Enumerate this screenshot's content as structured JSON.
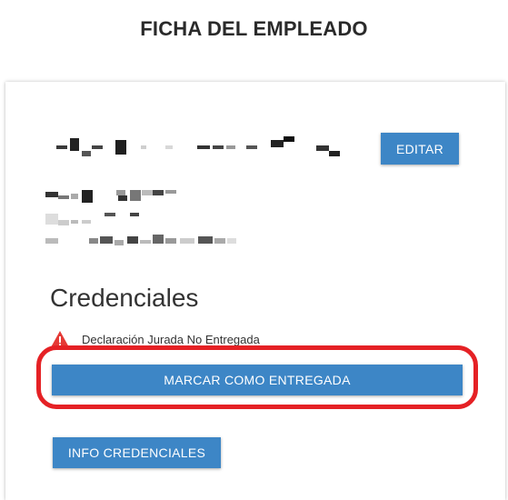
{
  "header": {
    "title": "FICHA DEL EMPLEADO"
  },
  "card": {
    "edit_label": "EDITAR",
    "credentials": {
      "title": "Credenciales",
      "warning_text": "Declaración Jurada No Entregada",
      "warning_icon": "warning-triangle-icon",
      "mark_delivered_label": "MARCAR COMO ENTREGADA",
      "info_label": "INFO CREDENCIALES"
    }
  },
  "colors": {
    "button": "#3d86c6",
    "warning": "#e53935",
    "highlight": "#e52125"
  }
}
